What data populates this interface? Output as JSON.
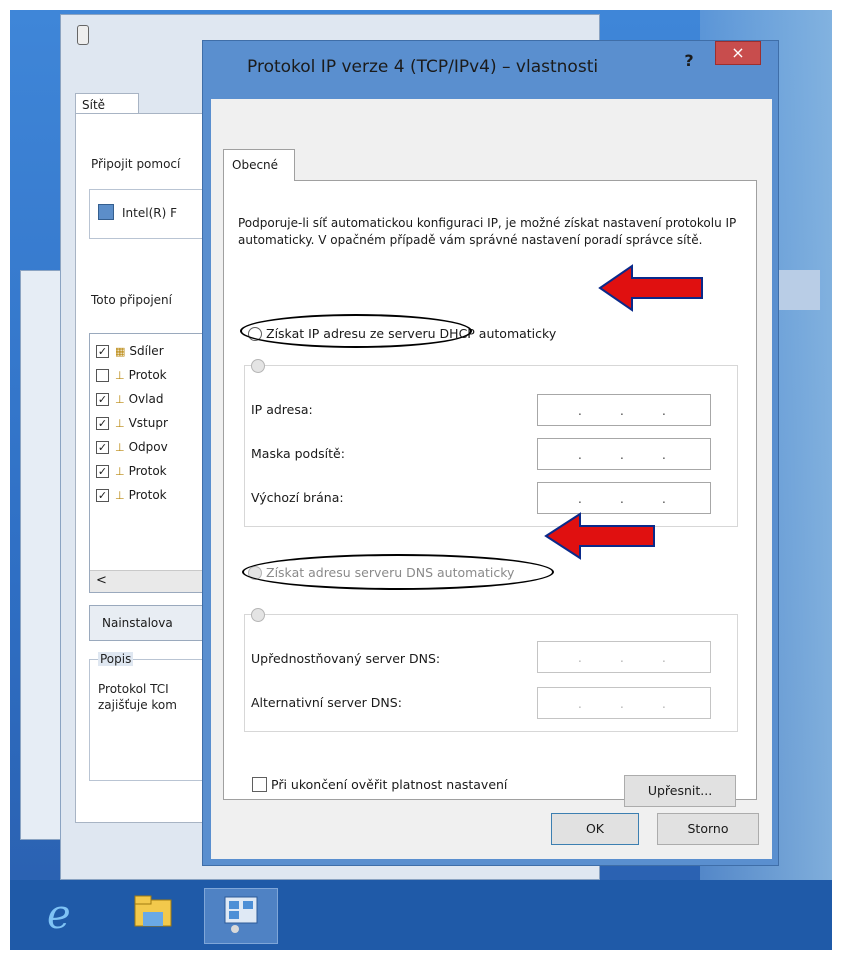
{
  "back_window": {
    "tab": "Sítě",
    "connect_using_label": "Připojit pomocí",
    "adapter_name": "Intel(R) F",
    "items_label": "Toto připojení",
    "items": [
      {
        "label": "Sdíler",
        "checked": true
      },
      {
        "label": "Protok",
        "checked": false
      },
      {
        "label": "Ovlad",
        "checked": true
      },
      {
        "label": "Vstupr",
        "checked": true
      },
      {
        "label": "Odpov",
        "checked": true
      },
      {
        "label": "Protok",
        "checked": true
      },
      {
        "label": "Protok",
        "checked": true
      }
    ],
    "scroll_left": "<",
    "install_button": "Nainstalova",
    "description_group": "Popis",
    "description_line1": "Protokol TCI",
    "description_line2": "zajišťuje kom"
  },
  "dialog": {
    "title": "Protokol IP verze 4 (TCP/IPv4) – vlastnosti",
    "help": "?",
    "close": "×",
    "tab": "Obecné",
    "intro": "Podporuje-li síť automatickou konfiguraci IP, je možné získat nastavení protokolu IP automaticky. V opačném případě vám správné nastavení poradí správce sítě.",
    "auto_ip_label": "Získat IP adresu ze serveru DHCP automaticky",
    "ip_address_label": "IP adresa:",
    "subnet_label": "Maska podsítě:",
    "gateway_label": "Výchozí brána:",
    "auto_dns_label": "Získat adresu serveru DNS automaticky",
    "preferred_dns_label": "Upřednostňovaný server DNS:",
    "alternate_dns_label": "Alternativní server DNS:",
    "validate_label": "Při ukončení ověřit platnost nastavení",
    "advanced_button": "Upřesnit...",
    "ok_button": "OK",
    "cancel_button": "Storno",
    "ip_dot": "."
  },
  "colors": {
    "annotation_arrow": "#e01010",
    "close_button": "#c84d4d",
    "dialog_frame": "#5a8fcf"
  },
  "taskbar": {
    "items": [
      "internet-explorer-icon",
      "file-explorer-icon",
      "network-control-panel-icon"
    ]
  }
}
